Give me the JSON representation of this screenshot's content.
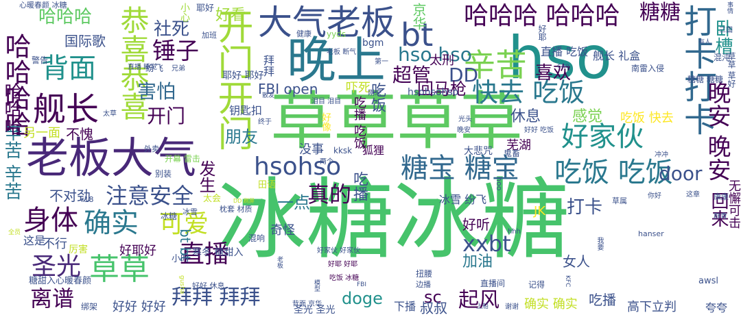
{
  "colors": {
    "background": "#ffffff",
    "palette": [
      "#46c36b",
      "#3b518b",
      "#440154",
      "#a0da39",
      "#2a788e",
      "#5ec962",
      "#21918c",
      "#fde725",
      "#31688e",
      "#c2df23",
      "#7ad151",
      "#482878"
    ]
  },
  "words": [
    {
      "text": "冰糖冰糖",
      "color": "#46c36b"
    },
    {
      "text": "草草草草",
      "color": "#5ec962"
    },
    {
      "text": "hso",
      "color": "#21918c"
    },
    {
      "text": "晚上",
      "color": "#2a788e"
    },
    {
      "text": "老板大气",
      "color": "#482878"
    },
    {
      "text": "大气老板",
      "color": "#3b518b"
    },
    {
      "text": "开门开门",
      "color": "#a0da39"
    },
    {
      "text": "恭喜恭喜",
      "color": "#a0da39"
    },
    {
      "text": "哈哈哈哈",
      "color": "#440154"
    },
    {
      "text": "哈哈哈 哈哈哈",
      "color": "#440154"
    },
    {
      "text": "打卡打卡",
      "color": "#31688e"
    },
    {
      "text": "bt",
      "color": "#3b518b"
    },
    {
      "text": "辛苦",
      "color": "#7ad151"
    },
    {
      "text": "舰长",
      "color": "#440154"
    },
    {
      "text": "背面",
      "color": "#21918c"
    },
    {
      "text": "锤子",
      "color": "#440154"
    },
    {
      "text": "快去 吃饭",
      "color": "#2a788e"
    },
    {
      "text": "好家伙",
      "color": "#21918c"
    },
    {
      "text": "hsohso",
      "color": "#3b518b"
    },
    {
      "text": "糖宝 糖宝",
      "color": "#31688e"
    },
    {
      "text": "吃饭 吃饭",
      "color": "#2a788e"
    },
    {
      "text": "身体",
      "color": "#440154"
    },
    {
      "text": "确实",
      "color": "#2a788e"
    },
    {
      "text": "草草",
      "color": "#46c36b"
    },
    {
      "text": "圣光",
      "color": "#482878"
    },
    {
      "text": "直播",
      "color": "#440154"
    },
    {
      "text": "可爱",
      "color": "#c2df23"
    },
    {
      "text": "注意安全",
      "color": "#3b518b"
    },
    {
      "text": "真的",
      "color": "#440154"
    },
    {
      "text": "拜拜 拜拜",
      "color": "#3b518b"
    },
    {
      "text": "离谱",
      "color": "#440154"
    },
    {
      "text": "xxbt",
      "color": "#3b518b"
    },
    {
      "text": "晚安 晚安",
      "color": "#440154"
    },
    {
      "text": "回来",
      "color": "#440154"
    },
    {
      "text": "无懈可击",
      "color": "#440154"
    },
    {
      "text": "糖糖",
      "color": "#440154"
    },
    {
      "text": "卧槽",
      "color": "#21918c"
    },
    {
      "text": "超管",
      "color": "#440154"
    },
    {
      "text": "DD",
      "color": "#3b518b"
    },
    {
      "text": "hso hso",
      "color": "#2a788e"
    },
    {
      "text": "喜欢",
      "color": "#440154"
    },
    {
      "text": "害怕",
      "color": "#31688e"
    },
    {
      "text": "开门",
      "color": "#440154"
    },
    {
      "text": "社死",
      "color": "#3b518b"
    },
    {
      "text": "哈哈哈",
      "color": "#5ec962"
    },
    {
      "text": "国际歌",
      "color": "#3b518b"
    },
    {
      "text": "FBI open",
      "color": "#3b518b"
    },
    {
      "text": "回马枪",
      "color": "#440154"
    },
    {
      "text": "吓死",
      "color": "#c2df23"
    },
    {
      "text": "休息",
      "color": "#3b518b"
    },
    {
      "text": "感觉",
      "color": "#7ad151"
    },
    {
      "text": "吃饭 快去",
      "color": "#fde725"
    },
    {
      "text": "door",
      "color": "#3b518b"
    },
    {
      "text": "不愧",
      "color": "#440154"
    },
    {
      "text": "朋友",
      "color": "#2a788e"
    },
    {
      "text": "另一面",
      "color": "#c2df23"
    },
    {
      "text": "不对劲",
      "color": "#3b518b"
    },
    {
      "text": "发生",
      "color": "#440154"
    },
    {
      "text": "一点",
      "color": "#2a788e"
    },
    {
      "text": "吃播",
      "color": "#3b518b"
    },
    {
      "text": "吃饭",
      "color": "#3b518b"
    },
    {
      "text": "打卡",
      "color": "#3b518b"
    },
    {
      "text": "JK",
      "color": "#fde725"
    },
    {
      "text": "好听",
      "color": "#440154"
    },
    {
      "text": "加油",
      "color": "#2a788e"
    },
    {
      "text": "女人",
      "color": "#3b518b"
    },
    {
      "text": "doge",
      "color": "#21918c"
    },
    {
      "text": "sc",
      "color": "#440154"
    },
    {
      "text": "起风",
      "color": "#440154"
    },
    {
      "text": "叔叔",
      "color": "#3b518b"
    },
    {
      "text": "确实 确实",
      "color": "#c2df23"
    },
    {
      "text": "吃播",
      "color": "#3b518b"
    },
    {
      "text": "高下立判",
      "color": "#3b518b"
    },
    {
      "text": "夸夸",
      "color": "#3b518b"
    },
    {
      "text": "好好 好好",
      "color": "#3b518b"
    },
    {
      "text": "辛苦 辛苦",
      "color": "#2a788e"
    },
    {
      "text": "哈哈哈",
      "color": "#440154"
    },
    {
      "text": "京华",
      "color": "#5ec962"
    },
    {
      "text": "好看",
      "color": "#a0da39"
    },
    {
      "text": "太刑",
      "color": "#440154"
    },
    {
      "text": "钥匙扣",
      "color": "#3b518b"
    },
    {
      "text": "奇怪",
      "color": "#3b518b"
    },
    {
      "text": "不行",
      "color": "#3b518b"
    },
    {
      "text": "这是",
      "color": "#3b518b"
    },
    {
      "text": "好耶好",
      "color": "#440154"
    },
    {
      "text": "冰雪 纷飞",
      "color": "#3b518b"
    },
    {
      "text": "芜湖",
      "color": "#440154"
    },
    {
      "text": "没事",
      "color": "#3b518b"
    },
    {
      "text": "吃播 吃饭",
      "color": "#440154"
    },
    {
      "text": "bgm",
      "color": "#3b518b"
    },
    {
      "text": "hsohsohso",
      "color": "#3b518b"
    },
    {
      "text": "直播 吃饭",
      "color": "#3b518b"
    },
    {
      "text": "舰长 礼盒",
      "color": "#3b518b"
    },
    {
      "text": "bt bt",
      "color": "#2a788e"
    },
    {
      "text": "下播",
      "color": "#3b518b"
    },
    {
      "text": "小心",
      "color": "#a0da39"
    },
    {
      "text": "耶好",
      "color": "#3b518b"
    },
    {
      "text": "耶好 耶好",
      "color": "#3b518b"
    },
    {
      "text": "好家伙 好家伙",
      "color": "#3b518b"
    },
    {
      "text": "糖甜入心暖春颜",
      "color": "#3b518b"
    },
    {
      "text": "心暖春颜 冰糖",
      "color": "#3b518b"
    },
    {
      "text": "寒冬 糖甜入",
      "color": "#3b518b"
    },
    {
      "text": "开幕 雷击",
      "color": "#7ad151"
    },
    {
      "text": "南雷入侵",
      "color": "#3b518b"
    },
    {
      "text": "草草 草好",
      "color": "#3b518b"
    },
    {
      "text": "糖糖 糖糖",
      "color": "#3b518b"
    },
    {
      "text": "三国",
      "color": "#3b518b"
    },
    {
      "text": "混沌",
      "color": "#3b518b"
    },
    {
      "text": "警告",
      "color": "#3b518b"
    },
    {
      "text": "健康",
      "color": "#3b518b"
    },
    {
      "text": "yyds",
      "color": "#7ad151"
    },
    {
      "text": "拜拜",
      "color": "#3b518b"
    },
    {
      "text": "老板 断气",
      "color": "#3b518b"
    },
    {
      "text": "冰糖",
      "color": "#3b518b"
    },
    {
      "text": "狐狸",
      "color": "#440154"
    },
    {
      "text": "kksk",
      "color": "#3b518b"
    },
    {
      "text": "大悲咒",
      "color": "#3b518b"
    },
    {
      "text": "光头",
      "color": "#3b518b"
    },
    {
      "text": "鬼畜",
      "color": "#3b518b"
    },
    {
      "text": "晚安",
      "color": "#3b518b"
    },
    {
      "text": "好好 吃饭",
      "color": "#3b518b"
    },
    {
      "text": "刚来",
      "color": "#3b518b"
    },
    {
      "text": "泪目 泪目",
      "color": "#3b518b"
    },
    {
      "text": "第一",
      "color": "#3b518b"
    },
    {
      "text": "外卖",
      "color": "#3b518b"
    },
    {
      "text": "别装",
      "color": "#3b518b"
    },
    {
      "text": "冰雪",
      "color": "#3b518b"
    },
    {
      "text": "枕套 材质",
      "color": "#3b518b"
    },
    {
      "text": "太会",
      "color": "#c2df23"
    },
    {
      "text": "DD 刷屏",
      "color": "#c2df23"
    },
    {
      "text": "田语",
      "color": "#c2df23"
    },
    {
      "text": "扭腰",
      "color": "#3b518b"
    },
    {
      "text": "好好 休息",
      "color": "#3b518b"
    },
    {
      "text": "好耶 好耶",
      "color": "#440154"
    },
    {
      "text": "hanser",
      "color": "#3b518b"
    },
    {
      "text": "awsl",
      "color": "#3b518b"
    },
    {
      "text": "群青",
      "color": "#3b518b"
    },
    {
      "text": "康康",
      "color": "#3b518b"
    },
    {
      "text": "草属",
      "color": "#3b518b"
    },
    {
      "text": "你好",
      "color": "#3b518b"
    },
    {
      "text": "边播",
      "color": "#3b518b"
    },
    {
      "text": "直播间",
      "color": "#3b518b"
    },
    {
      "text": "记得",
      "color": "#3b518b"
    },
    {
      "text": "FBI",
      "color": "#3b518b"
    },
    {
      "text": "KFC",
      "color": "#3b518b"
    },
    {
      "text": "谢谢",
      "color": "#3b518b"
    },
    {
      "text": "上船",
      "color": "#3b518b"
    },
    {
      "text": "背面 京华",
      "color": "#3b518b"
    },
    {
      "text": "绑架",
      "color": "#3b518b"
    },
    {
      "text": "吃饭 冰糖",
      "color": "#440154"
    },
    {
      "text": "厉害",
      "color": "#c2df23"
    },
    {
      "text": "混响",
      "color": "#3b518b"
    },
    {
      "text": "r18",
      "color": "#3b518b"
    },
    {
      "text": "hoo",
      "color": "#3b518b"
    },
    {
      "text": "冲冲",
      "color": "#3b518b"
    },
    {
      "text": "hhh",
      "color": "#3b518b"
    },
    {
      "text": "加班",
      "color": "#3b518b"
    },
    {
      "text": "事情",
      "color": "#3b518b"
    },
    {
      "text": "有人",
      "color": "#3b518b"
    },
    {
      "text": "兄弟",
      "color": "#3b518b"
    },
    {
      "text": "太草",
      "color": "#3b518b"
    },
    {
      "text": "终于",
      "color": "#3b518b"
    },
    {
      "text": "这章",
      "color": "#3b518b"
    },
    {
      "text": "cao",
      "color": "#3b518b"
    },
    {
      "text": "圣光 圣光",
      "color": "#3b518b"
    },
    {
      "text": "我要",
      "color": "#3b518b"
    },
    {
      "text": "全员",
      "color": "#c2df23"
    },
    {
      "text": "散发",
      "color": "#3b518b"
    },
    {
      "text": "纷飞",
      "color": "#3b518b"
    },
    {
      "text": "好耶",
      "color": "#3b518b"
    },
    {
      "text": "直播 睡觉",
      "color": "#3b518b"
    },
    {
      "text": "两个",
      "color": "#3b518b"
    },
    {
      "text": "好像",
      "color": "#fde725"
    },
    {
      "text": "小时",
      "color": "#3b518b"
    },
    {
      "text": "老板",
      "color": "#3b518b"
    },
    {
      "text": "gusha",
      "color": "#c2df23"
    },
    {
      "text": "模型",
      "color": "#3b518b"
    }
  ]
}
